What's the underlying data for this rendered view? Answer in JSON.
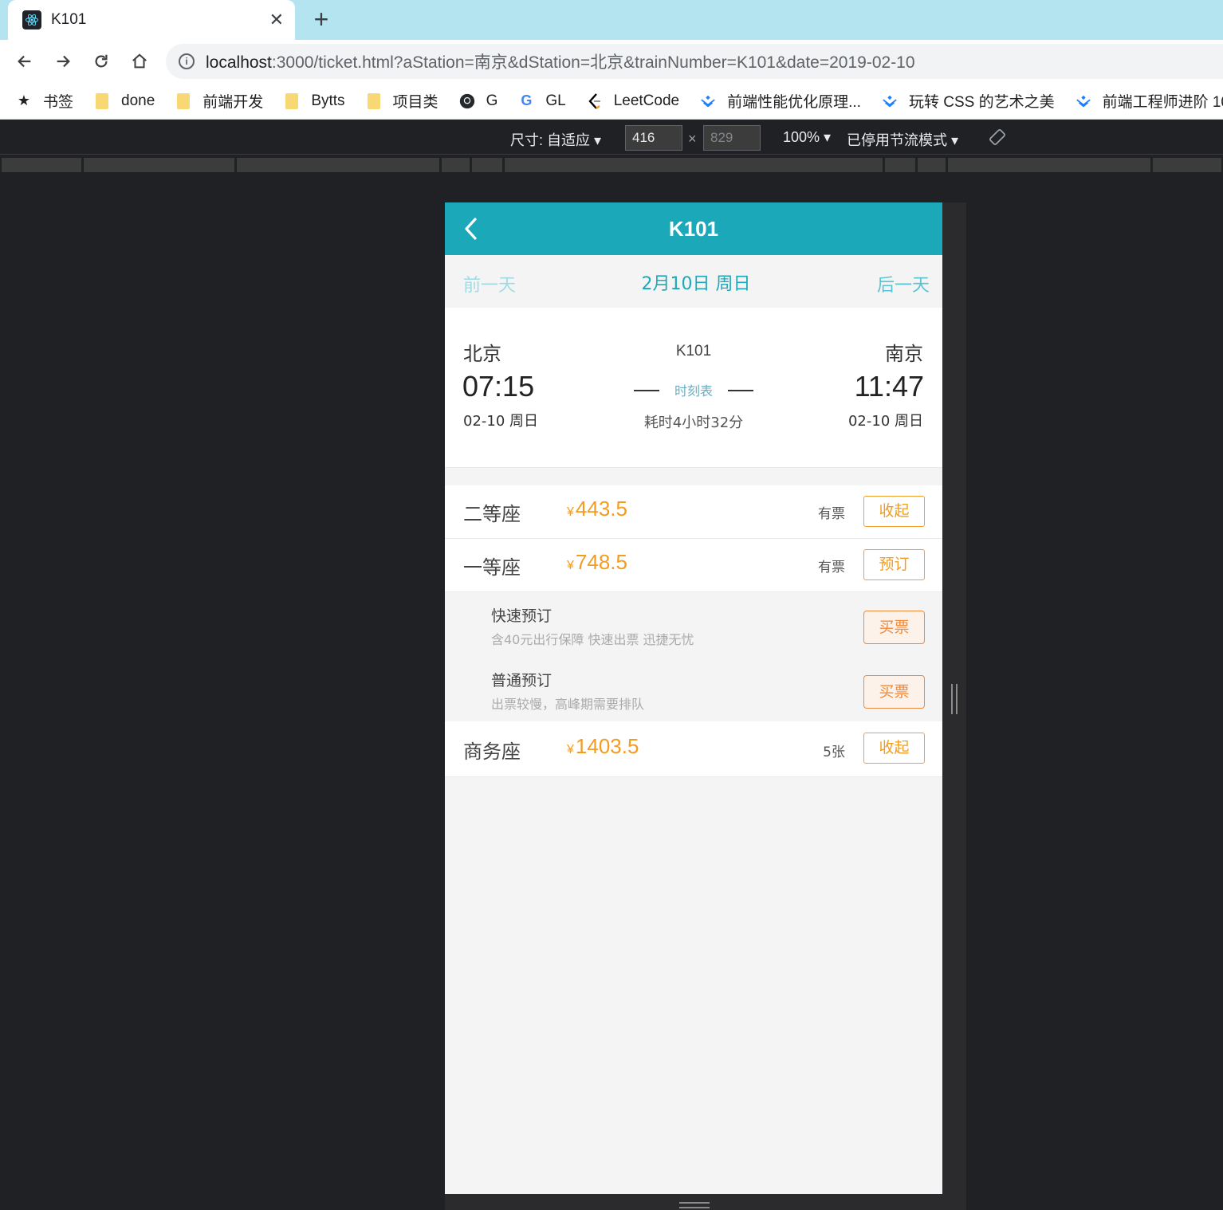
{
  "browser": {
    "tab_title": "K101",
    "url_host": "localhost",
    "url_rest": ":3000/ticket.html?aStation=南京&dStation=北京&trainNumber=K101&date=2019-02-10",
    "bookmarks": [
      {
        "label": "书签",
        "icon": "star-icon"
      },
      {
        "label": "done",
        "icon": "folder-icon"
      },
      {
        "label": "前端开发",
        "icon": "folder-icon"
      },
      {
        "label": "Bytts",
        "icon": "folder-icon"
      },
      {
        "label": "项目类",
        "icon": "folder-icon"
      },
      {
        "label": "G",
        "icon": "github-icon"
      },
      {
        "label": "GL",
        "icon": "google-icon"
      },
      {
        "label": "LeetCode",
        "icon": "leetcode-icon"
      },
      {
        "label": "前端性能优化原理...",
        "icon": "juejin-icon"
      },
      {
        "label": "玩转 CSS 的艺术之美",
        "icon": "juejin-icon"
      },
      {
        "label": "前端工程师进阶 10...",
        "icon": "juejin-icon"
      }
    ]
  },
  "device_toolbar": {
    "size_label": "尺寸: 自适应",
    "width": "416",
    "height": "829",
    "zoom": "100%",
    "throttle": "已停用节流模式"
  },
  "app": {
    "header_title": "K101",
    "prev_day": "前一天",
    "current_date": "2月10日 周日",
    "next_day": "后一天",
    "departure": {
      "city": "北京",
      "time": "07:15",
      "date": "02-10 周日"
    },
    "arrival": {
      "city": "南京",
      "time": "11:47",
      "date": "02-10 周日"
    },
    "train_number": "K101",
    "timetable_link": "时刻表",
    "duration": "耗时4小时32分",
    "currency_symbol": "¥",
    "seats": [
      {
        "name": "二等座",
        "price": "443.5",
        "tickets": "有票",
        "action": "收起"
      },
      {
        "name": "一等座",
        "price": "748.5",
        "tickets": "有票",
        "action": "预订"
      },
      {
        "name": "商务座",
        "price": "1403.5",
        "tickets": "5张",
        "action": "收起"
      }
    ],
    "channels": [
      {
        "name": "快速预订",
        "desc": "含40元出行保障 快速出票 迅捷无忧",
        "action": "买票"
      },
      {
        "name": "普通预订",
        "desc": "出票较慢，高峰期需要排队",
        "action": "买票"
      }
    ]
  },
  "colors": {
    "header_bg": "#1ba9ba",
    "price": "#f39c1f",
    "buy_border": "#f08a3c"
  }
}
